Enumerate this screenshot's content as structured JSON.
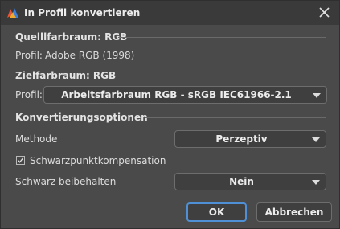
{
  "window": {
    "title": "In Profil konvertieren",
    "app_icon": "photoshop-app-icon",
    "close_icon": "close-icon"
  },
  "source": {
    "heading": "Quelllfarbraum: RGB",
    "profile_label": "Profil:",
    "profile_value": "Adobe RGB (1998)"
  },
  "target": {
    "heading": "Zielfarbraum: RGB",
    "profile_label": "Profil:",
    "profile_selected": "Arbeitsfarbraum RGB - sRGB IEC61966-2.1"
  },
  "options": {
    "heading": "Konvertierungsoptionen",
    "method_label": "Methode",
    "method_selected": "Perzeptiv",
    "bpc_label": "Schwarzpunktkompensation",
    "bpc_checked": true,
    "keep_black_label": "Schwarz beibehalten",
    "keep_black_selected": "Nein"
  },
  "buttons": {
    "ok": "OK",
    "cancel": "Abbrechen"
  },
  "colors": {
    "background": "#4a4a4a",
    "titlebar": "#3a3a3a",
    "primary_border": "#4e8fd6"
  }
}
